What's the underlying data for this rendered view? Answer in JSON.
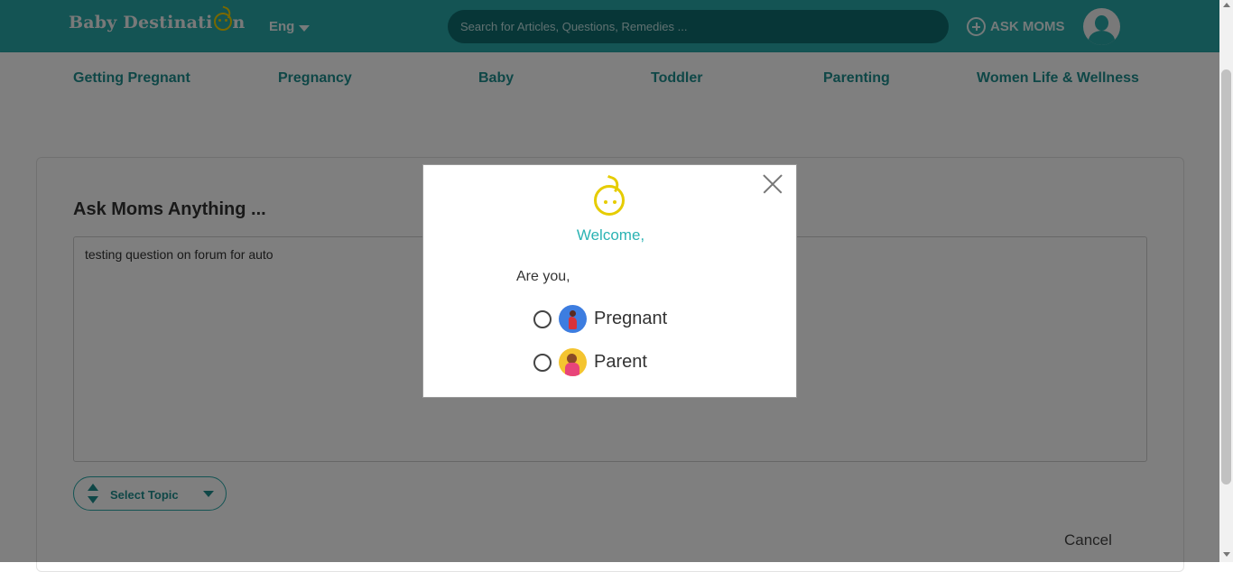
{
  "header": {
    "logo_text_1": "Baby Destinati",
    "logo_text_2": "n",
    "language": "Eng",
    "search_placeholder": "Search for Articles, Questions, Remedies ...",
    "ask_moms": "ASK MOMS"
  },
  "nav": {
    "items": [
      {
        "label": "Getting Pregnant"
      },
      {
        "label": "Pregnancy"
      },
      {
        "label": "Baby"
      },
      {
        "label": "Toddler"
      },
      {
        "label": "Parenting"
      },
      {
        "label": "Women Life & Wellness"
      }
    ]
  },
  "main": {
    "title": "Ask Moms Anything ...",
    "question_value": "testing question on forum for auto",
    "select_topic": "Select Topic",
    "cancel": "Cancel"
  },
  "modal": {
    "welcome": "Welcome,",
    "prompt": "Are you,",
    "options": [
      {
        "label": "Pregnant",
        "icon": "pregnant-woman-icon"
      },
      {
        "label": "Parent",
        "icon": "parent-with-baby-icon"
      }
    ]
  },
  "colors": {
    "brand": "#28a8a8",
    "nav_text": "#1e8f8f",
    "accent_yellow": "#f0d000",
    "welcome_text": "#2bb3b3"
  }
}
